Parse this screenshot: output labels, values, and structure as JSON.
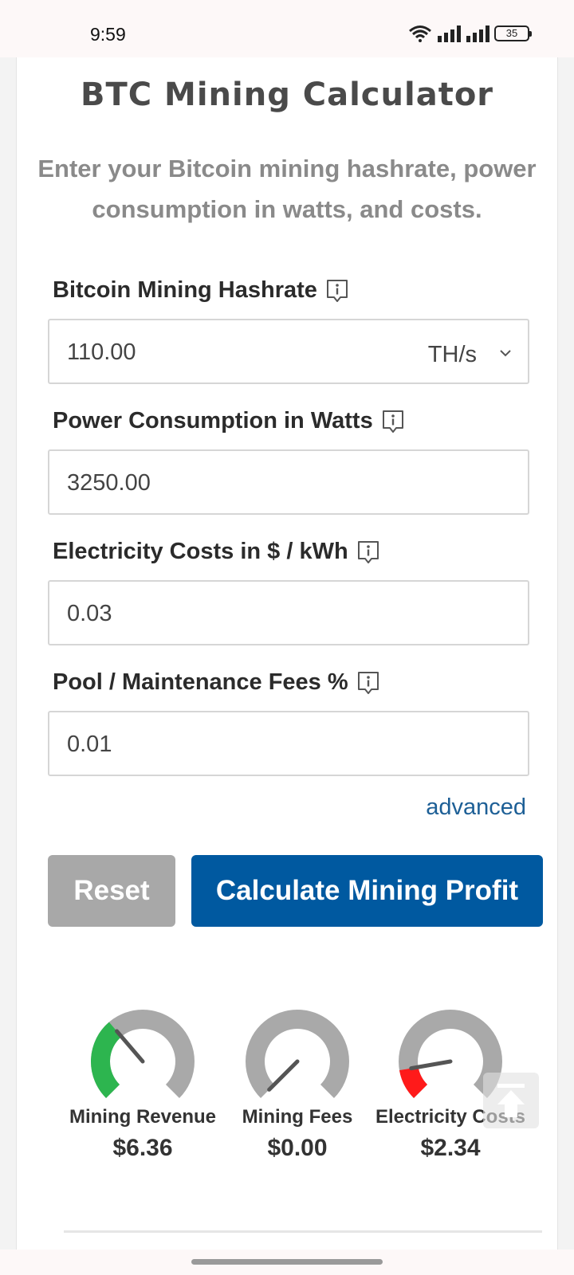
{
  "status_bar": {
    "time": "9:59",
    "battery": "35"
  },
  "title": "BTC Mining Calculator",
  "subtitle": "Enter your Bitcoin mining hashrate, power consumption in watts, and costs.",
  "fields": [
    {
      "label": "Bitcoin Mining Hashrate",
      "value": "110.00",
      "unit": "TH/s",
      "icon": "info-icon"
    },
    {
      "label": "Power Consumption in Watts",
      "value": "3250.00",
      "icon": "info-icon"
    },
    {
      "label": "Electricity Costs in $ / kWh",
      "value": "0.03",
      "icon": "info-icon"
    },
    {
      "label": "Pool / Maintenance Fees %",
      "value": "0.01",
      "icon": "info-icon"
    }
  ],
  "advanced_link": "advanced",
  "buttons": {
    "reset": "Reset",
    "calculate": "Calculate Mining Profit"
  },
  "gauges": [
    {
      "label": "Mining Revenue",
      "value": "$6.36",
      "fill_fraction": 0.35,
      "color": "#2db54f"
    },
    {
      "label": "Mining Fees",
      "value": "$0.00",
      "fill_fraction": 0.0,
      "color": "#e0e0e0"
    },
    {
      "label": "Electricity Costs",
      "value": "$2.34",
      "fill_fraction": 0.13,
      "color": "#ff1a1a"
    }
  ],
  "colors": {
    "accent": "#0059a0",
    "link": "#1d5f96",
    "reset": "#a8a8a8",
    "gauge_track": "#a9a9a9"
  }
}
